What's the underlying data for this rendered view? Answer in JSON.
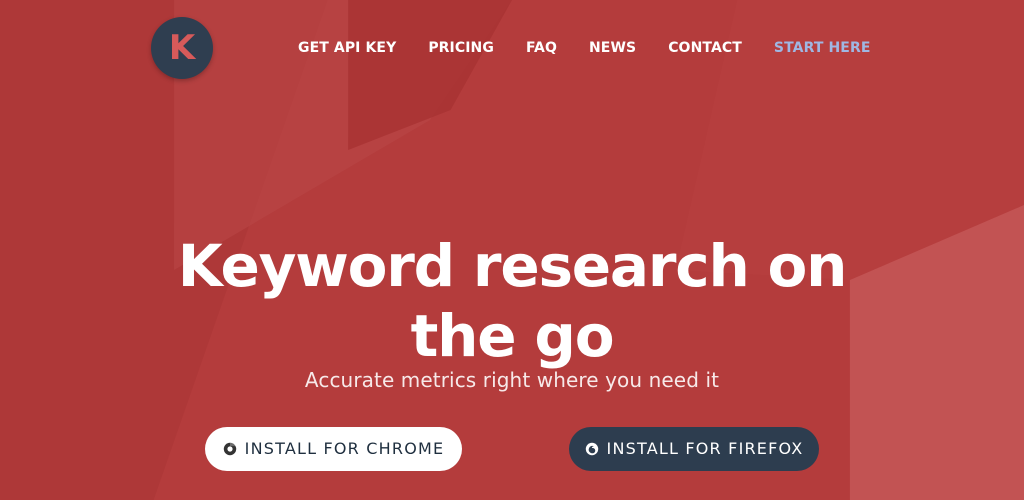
{
  "brand": {
    "logo_letter": "K"
  },
  "nav": {
    "items": [
      {
        "label": "GET API KEY"
      },
      {
        "label": "PRICING"
      },
      {
        "label": "FAQ"
      },
      {
        "label": "NEWS"
      },
      {
        "label": "CONTACT"
      },
      {
        "label": "START HERE"
      }
    ]
  },
  "hero": {
    "title_line_1": "Keyword research on",
    "title_line_2": "the go",
    "subtitle": "Accurate metrics right where you need it"
  },
  "actions": {
    "chrome_label": "INSTALL FOR CHROME",
    "firefox_label": "INSTALL FOR FIREFOX"
  },
  "colors": {
    "background": "#b43c3c",
    "logo_background": "#2f3e50",
    "logo_letter": "#d75a5a",
    "start_here": "#9fb7e3",
    "firefox_button": "#2d3d4f",
    "chrome_button": "#ffffff"
  },
  "icons": {
    "chrome": "chrome-icon",
    "firefox": "firefox-icon"
  }
}
